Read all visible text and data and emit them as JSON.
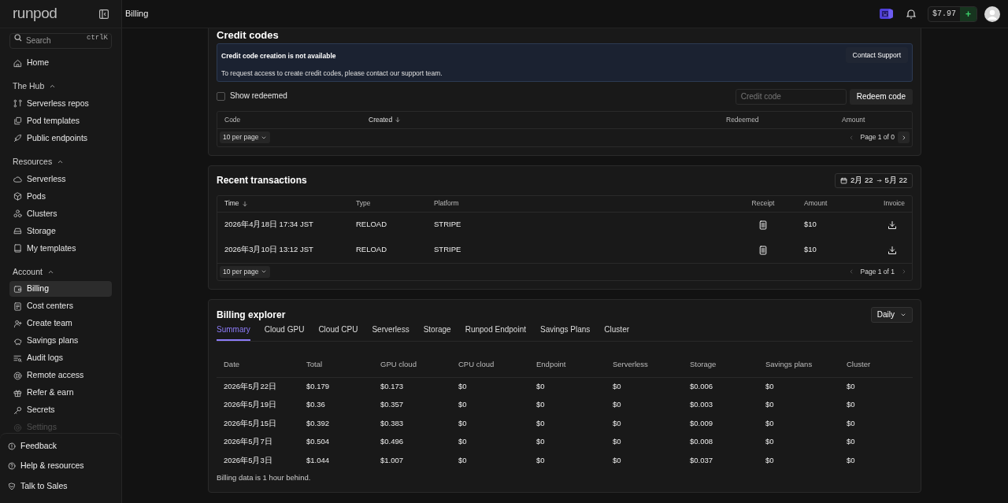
{
  "sidebar": {
    "logo": "runpod",
    "search": {
      "placeholder": "Search",
      "shortcut": "ctrlK"
    },
    "home": {
      "label": "Home",
      "selected": false
    },
    "sections": [
      {
        "title": "The Hub",
        "expanded": true,
        "items": [
          {
            "label": "Serverless repos",
            "selected": false
          },
          {
            "label": "Pod templates",
            "selected": false
          },
          {
            "label": "Public endpoints",
            "selected": false
          }
        ]
      },
      {
        "title": "Resources",
        "expanded": true,
        "items": [
          {
            "label": "Serverless",
            "selected": false
          },
          {
            "label": "Pods",
            "selected": false
          },
          {
            "label": "Clusters",
            "selected": false
          },
          {
            "label": "Storage",
            "selected": false
          },
          {
            "label": "My templates",
            "selected": false
          }
        ]
      },
      {
        "title": "Account",
        "expanded": true,
        "items": [
          {
            "label": "Billing",
            "selected": true
          },
          {
            "label": "Cost centers",
            "selected": false
          },
          {
            "label": "Create team",
            "selected": false
          },
          {
            "label": "Savings plans",
            "selected": false
          },
          {
            "label": "Audit logs",
            "selected": false
          },
          {
            "label": "Remote access",
            "selected": false
          },
          {
            "label": "Refer & earn",
            "selected": false
          },
          {
            "label": "Secrets",
            "selected": false
          },
          {
            "label": "Settings",
            "selected": false
          }
        ]
      }
    ],
    "bottom": [
      "Feedback",
      "Help & resources",
      "Talk to Sales"
    ]
  },
  "topbar": {
    "title": "Billing",
    "balance": "$7.97",
    "add": "+"
  },
  "credit_codes": {
    "title": "Credit codes",
    "notice": {
      "title": "Credit code creation is not available",
      "text": "To request access to create credit codes, please contact our support team.",
      "button": "Contact Support"
    },
    "show_redeemed": {
      "label": "Show redeemed",
      "checked": false
    },
    "code_input": {
      "placeholder": "Credit code"
    },
    "redeem_button": "Redeem code",
    "columns": [
      {
        "label": "Code",
        "sorted": false
      },
      {
        "label": "Created",
        "sorted": true
      },
      {
        "label": "Redeemed",
        "sorted": false
      },
      {
        "label": "Amount",
        "sorted": false
      }
    ],
    "page_size": "10 per page",
    "pagination": {
      "label": "Page 1 of 0",
      "prev_disabled": true,
      "next_disabled": false
    }
  },
  "transactions": {
    "title": "Recent transactions",
    "date_range": {
      "from": "2月 22",
      "to": "5月 22"
    },
    "columns": [
      {
        "label": "Time",
        "sorted": true
      },
      {
        "label": "Type",
        "sorted": false
      },
      {
        "label": "Platform",
        "sorted": false
      },
      {
        "label": "Receipt",
        "sorted": false
      },
      {
        "label": "Amount",
        "sorted": false
      },
      {
        "label": "Invoice",
        "sorted": false
      }
    ],
    "rows": [
      {
        "time": "2026年4月18日 17:34 JST",
        "type": "RELOAD",
        "platform": "STRIPE",
        "amount": "$10"
      },
      {
        "time": "2026年3月10日 13:12 JST",
        "type": "RELOAD",
        "platform": "STRIPE",
        "amount": "$10"
      }
    ],
    "page_size": "10 per page",
    "pagination": {
      "label": "Page 1 of 1",
      "prev_disabled": true,
      "next_disabled": true
    }
  },
  "billing_explorer": {
    "title": "Billing explorer",
    "granularity": "Daily",
    "tabs": [
      {
        "label": "Summary",
        "selected": true
      },
      {
        "label": "Cloud GPU",
        "selected": false
      },
      {
        "label": "Cloud CPU",
        "selected": false
      },
      {
        "label": "Serverless",
        "selected": false
      },
      {
        "label": "Storage",
        "selected": false
      },
      {
        "label": "Runpod Endpoint",
        "selected": false
      },
      {
        "label": "Savings Plans",
        "selected": false
      },
      {
        "label": "Cluster",
        "selected": false
      }
    ],
    "columns": [
      "Date",
      "Total",
      "GPU cloud",
      "CPU cloud",
      "Endpoint",
      "Serverless",
      "Storage",
      "Savings plans",
      "Cluster"
    ],
    "rows": [
      [
        "2026年5月22日",
        "$0.179",
        "$0.173",
        "$0",
        "$0",
        "$0",
        "$0.006",
        "$0",
        "$0"
      ],
      [
        "2026年5月19日",
        "$0.36",
        "$0.357",
        "$0",
        "$0",
        "$0",
        "$0.003",
        "$0",
        "$0"
      ],
      [
        "2026年5月15日",
        "$0.392",
        "$0.383",
        "$0",
        "$0",
        "$0",
        "$0.009",
        "$0",
        "$0"
      ],
      [
        "2026年5月7日",
        "$0.504",
        "$0.496",
        "$0",
        "$0",
        "$0",
        "$0.008",
        "$0",
        "$0"
      ],
      [
        "2026年5月3日",
        "$1.044",
        "$1.007",
        "$0",
        "$0",
        "$0",
        "$0.037",
        "$0",
        "$0"
      ]
    ],
    "note": "Billing data is 1 hour behind."
  }
}
